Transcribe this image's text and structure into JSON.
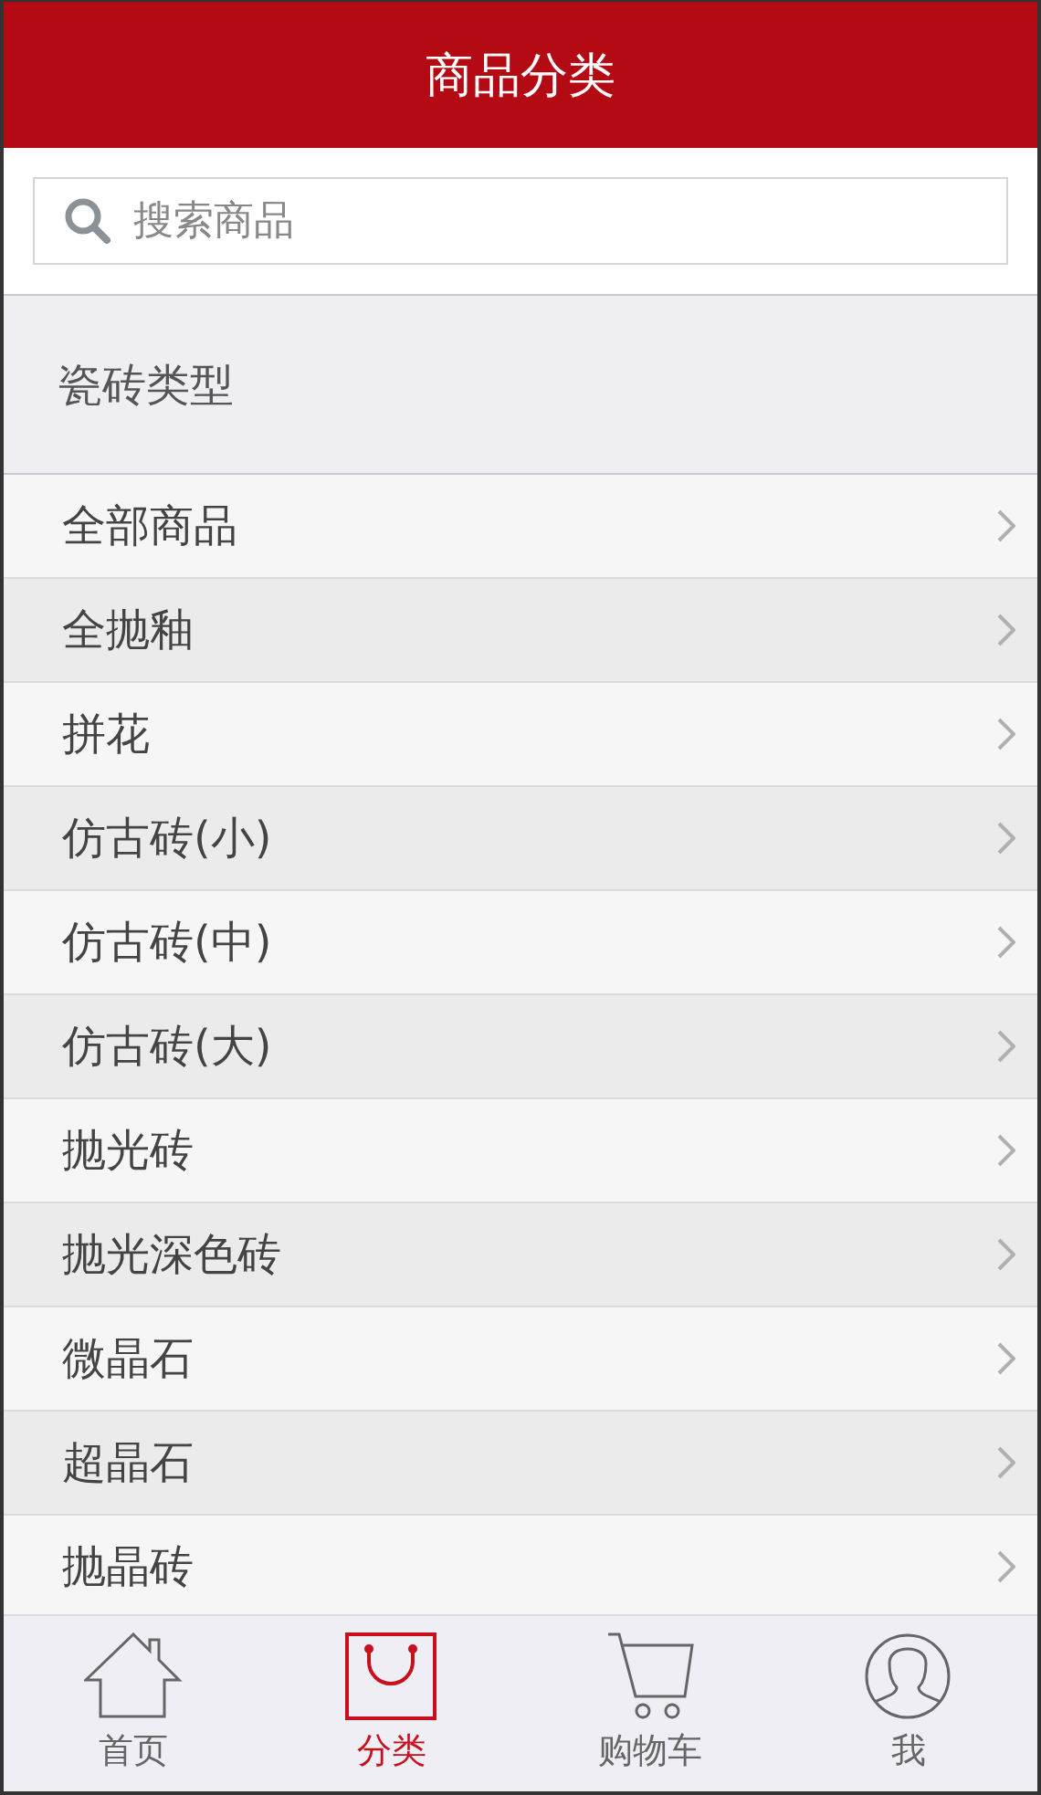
{
  "header": {
    "title": "商品分类"
  },
  "search": {
    "placeholder": "搜索商品"
  },
  "section": {
    "title": "瓷砖类型"
  },
  "categories": [
    {
      "label": "全部商品"
    },
    {
      "label": "全抛釉"
    },
    {
      "label": "拼花"
    },
    {
      "label": "仿古砖(小)"
    },
    {
      "label": "仿古砖(中)"
    },
    {
      "label": "仿古砖(大)"
    },
    {
      "label": "抛光砖"
    },
    {
      "label": "抛光深色砖"
    },
    {
      "label": "微晶石"
    },
    {
      "label": "超晶石"
    },
    {
      "label": "抛晶砖"
    }
  ],
  "tabs": [
    {
      "label": "首页",
      "kind": "home",
      "selected": false
    },
    {
      "label": "分类",
      "kind": "bag",
      "selected": true
    },
    {
      "label": "购物车",
      "kind": "cart",
      "selected": false
    },
    {
      "label": "我",
      "kind": "user",
      "selected": false
    }
  ]
}
